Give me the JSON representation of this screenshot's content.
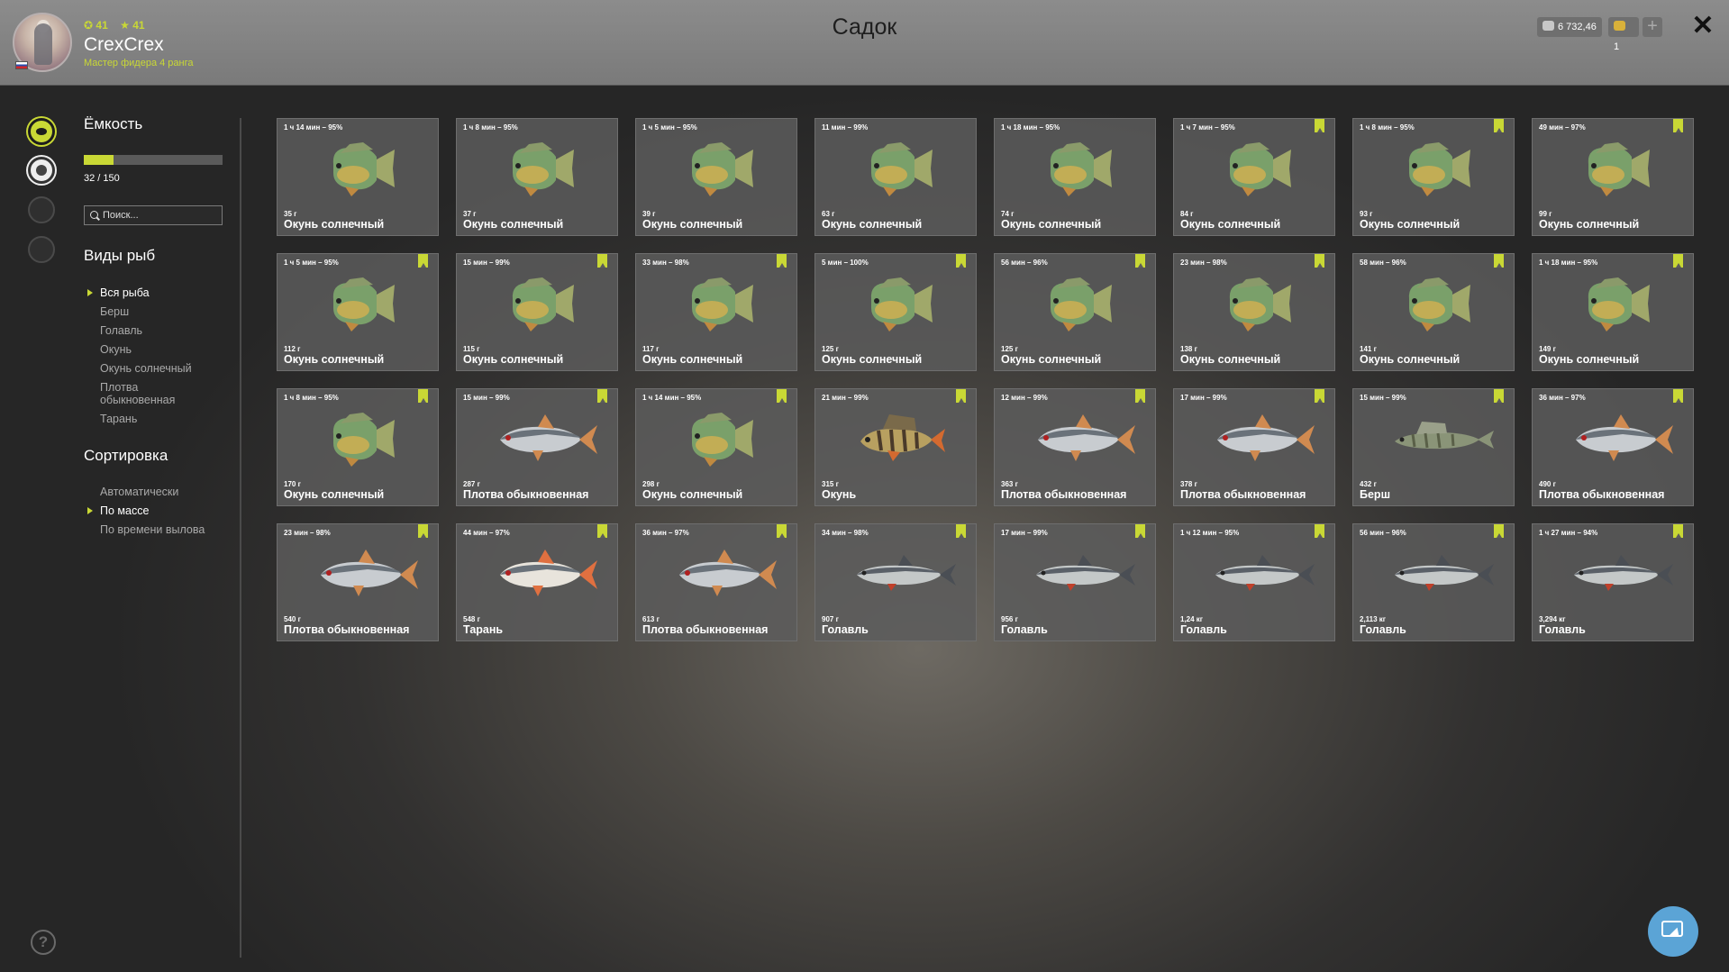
{
  "header": {
    "title": "Садок",
    "level_green": "41",
    "level_yellow": "41",
    "username": "CrexCrex",
    "rank": "Мастер фидера 4 ранга",
    "silver": "6 732,46",
    "gold": "1",
    "plus": "+",
    "close": "✕"
  },
  "sidebar": {
    "capacity_title": "Ёмкость",
    "capacity_text": "32 / 150",
    "capacity_fraction": 0.2133,
    "search_placeholder": "Поиск...",
    "species_title": "Виды рыб",
    "species": [
      "Вся рыба",
      "Берш",
      "Голавль",
      "Окунь",
      "Окунь солнечный",
      "Плотва обыкновенная",
      "Тарань"
    ],
    "sort_title": "Сортировка",
    "sort_options": [
      "Автоматически",
      "По массе",
      "По времени вылова"
    ],
    "help": "?"
  },
  "colors": {
    "accent": "#c9d835",
    "fab": "#5ba4d6"
  },
  "cards": [
    {
      "time": "1 ч 14 мин – 95%",
      "weight": "35 г",
      "name": "Окунь солнечный",
      "type": "sunfish",
      "marked": false
    },
    {
      "time": "1 ч 8 мин – 95%",
      "weight": "37 г",
      "name": "Окунь солнечный",
      "type": "sunfish",
      "marked": false
    },
    {
      "time": "1 ч 5 мин – 95%",
      "weight": "39 г",
      "name": "Окунь солнечный",
      "type": "sunfish",
      "marked": false
    },
    {
      "time": "11 мин – 99%",
      "weight": "63 г",
      "name": "Окунь солнечный",
      "type": "sunfish",
      "marked": false
    },
    {
      "time": "1 ч 18 мин – 95%",
      "weight": "74 г",
      "name": "Окунь солнечный",
      "type": "sunfish",
      "marked": false
    },
    {
      "time": "1 ч 7 мин – 95%",
      "weight": "84 г",
      "name": "Окунь солнечный",
      "type": "sunfish",
      "marked": true
    },
    {
      "time": "1 ч 8 мин – 95%",
      "weight": "93 г",
      "name": "Окунь солнечный",
      "type": "sunfish",
      "marked": true
    },
    {
      "time": "49 мин – 97%",
      "weight": "99 г",
      "name": "Окунь солнечный",
      "type": "sunfish",
      "marked": true
    },
    {
      "time": "1 ч 5 мин – 95%",
      "weight": "112 г",
      "name": "Окунь солнечный",
      "type": "sunfish",
      "marked": true
    },
    {
      "time": "15 мин – 99%",
      "weight": "115 г",
      "name": "Окунь солнечный",
      "type": "sunfish",
      "marked": true
    },
    {
      "time": "33 мин – 98%",
      "weight": "117 г",
      "name": "Окунь солнечный",
      "type": "sunfish",
      "marked": true
    },
    {
      "time": "5 мин – 100%",
      "weight": "125 г",
      "name": "Окунь солнечный",
      "type": "sunfish",
      "marked": true
    },
    {
      "time": "56 мин – 96%",
      "weight": "125 г",
      "name": "Окунь солнечный",
      "type": "sunfish",
      "marked": true
    },
    {
      "time": "23 мин – 98%",
      "weight": "138 г",
      "name": "Окунь солнечный",
      "type": "sunfish",
      "marked": true
    },
    {
      "time": "58 мин – 96%",
      "weight": "141 г",
      "name": "Окунь солнечный",
      "type": "sunfish",
      "marked": true
    },
    {
      "time": "1 ч 18 мин – 95%",
      "weight": "149 г",
      "name": "Окунь солнечный",
      "type": "sunfish",
      "marked": true
    },
    {
      "time": "1 ч 8 мин – 95%",
      "weight": "170 г",
      "name": "Окунь солнечный",
      "type": "sunfish",
      "marked": true
    },
    {
      "time": "15 мин – 99%",
      "weight": "287 г",
      "name": "Плотва обыкновенная",
      "type": "roach",
      "marked": true
    },
    {
      "time": "1 ч 14 мин – 95%",
      "weight": "298 г",
      "name": "Окунь солнечный",
      "type": "sunfish",
      "marked": true
    },
    {
      "time": "21 мин – 99%",
      "weight": "315 г",
      "name": "Окунь",
      "type": "perch",
      "marked": true
    },
    {
      "time": "12 мин – 99%",
      "weight": "363 г",
      "name": "Плотва обыкновенная",
      "type": "roach",
      "marked": true
    },
    {
      "time": "17 мин – 99%",
      "weight": "378 г",
      "name": "Плотва обыкновенная",
      "type": "roach",
      "marked": true
    },
    {
      "time": "15 мин – 99%",
      "weight": "432 г",
      "name": "Берш",
      "type": "bersh",
      "marked": true
    },
    {
      "time": "36 мин – 97%",
      "weight": "490 г",
      "name": "Плотва обыкновенная",
      "type": "roach",
      "marked": true
    },
    {
      "time": "23 мин – 98%",
      "weight": "540 г",
      "name": "Плотва обыкновенная",
      "type": "roach",
      "marked": true
    },
    {
      "time": "44 мин – 97%",
      "weight": "548 г",
      "name": "Тарань",
      "type": "taran",
      "marked": true
    },
    {
      "time": "36 мин – 97%",
      "weight": "613 г",
      "name": "Плотва обыкновенная",
      "type": "roach",
      "marked": true
    },
    {
      "time": "34 мин – 98%",
      "weight": "907 г",
      "name": "Голавль",
      "type": "chub",
      "marked": true
    },
    {
      "time": "17 мин – 99%",
      "weight": "956 г",
      "name": "Голавль",
      "type": "chub",
      "marked": true
    },
    {
      "time": "1 ч 12 мин – 95%",
      "weight": "1,24 кг",
      "name": "Голавль",
      "type": "chub",
      "marked": true
    },
    {
      "time": "56 мин – 96%",
      "weight": "2,113 кг",
      "name": "Голавль",
      "type": "chub",
      "marked": true
    },
    {
      "time": "1 ч 27 мин – 94%",
      "weight": "3,294 кг",
      "name": "Голавль",
      "type": "chub",
      "marked": true
    }
  ]
}
